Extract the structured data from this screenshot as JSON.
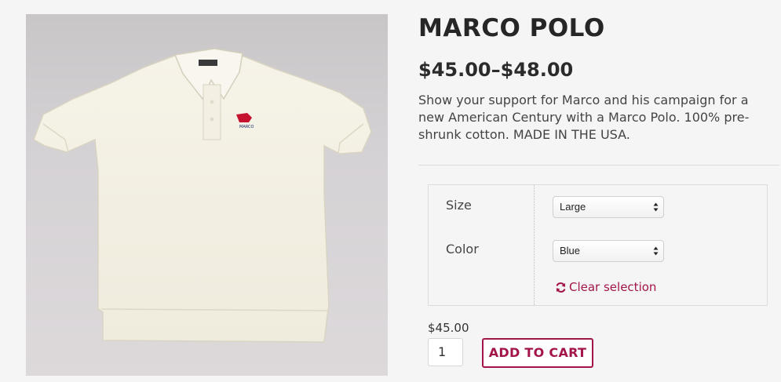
{
  "product": {
    "title": "MARCO POLO",
    "price_range": "$45.00–$48.00",
    "description": "Show your support for Marco and his campaign for a new American Century with a Marco Polo. 100% pre-shrunk cotton. MADE IN THE USA.",
    "image_alt": "White polo shirt",
    "logo_text": "MARCO"
  },
  "variations": {
    "size_label": "Size",
    "size_value": "Large",
    "color_label": "Color",
    "color_value": "Blue",
    "clear_label": "Clear selection"
  },
  "cart": {
    "variation_price": "$45.00",
    "quantity": "1",
    "add_to_cart_label": "ADD TO CART"
  },
  "colors": {
    "accent": "#a3154a",
    "title": "#262626"
  },
  "icons": {
    "clear": "refresh-icon",
    "select": "select-arrows-icon"
  }
}
